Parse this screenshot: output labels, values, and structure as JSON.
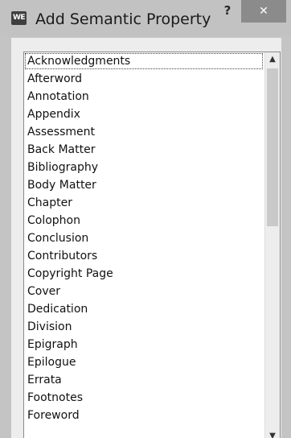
{
  "window": {
    "app_icon_text": "WE",
    "title": "Add Semantic Property",
    "help_label": "?",
    "close_label": "✕"
  },
  "list": {
    "items": [
      "Acknowledgments",
      "Afterword",
      "Annotation",
      "Appendix",
      "Assessment",
      "Back Matter",
      "Bibliography",
      "Body Matter",
      "Chapter",
      "Colophon",
      "Conclusion",
      "Contributors",
      "Copyright Page",
      "Cover",
      "Dedication",
      "Division",
      "Epigraph",
      "Epilogue",
      "Errata",
      "Footnotes",
      "Foreword"
    ],
    "focused_index": 0
  },
  "scrollbar": {
    "up_arrow": "▲",
    "down_arrow": "▼",
    "position": 0
  }
}
